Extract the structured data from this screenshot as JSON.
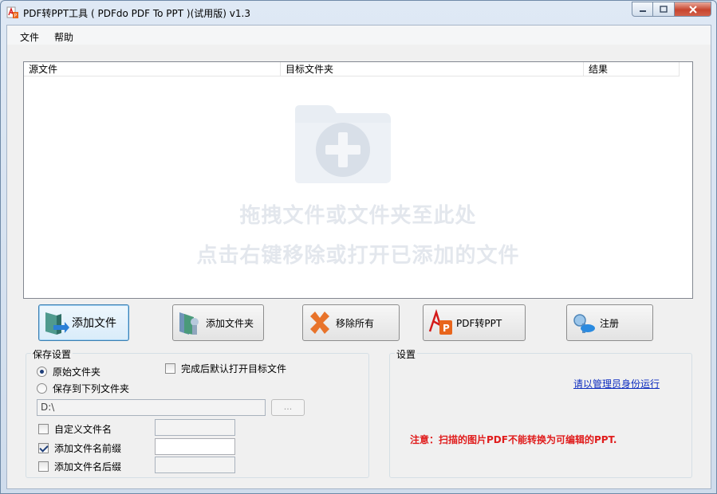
{
  "window": {
    "title": "PDF转PPT工具 ( PDFdo PDF To PPT )(试用版) v1.3"
  },
  "menu": {
    "items": [
      {
        "label": "文件"
      },
      {
        "label": "帮助"
      }
    ]
  },
  "file_list": {
    "columns": [
      "源文件",
      "目标文件夹",
      "结果"
    ],
    "rows": [],
    "hint_line1": "拖拽文件或文件夹至此处",
    "hint_line2": "点击右键移除或打开已添加的文件",
    "hint_icon": "folder-add-icon"
  },
  "toolbar": {
    "add_file": "添加文件",
    "add_folder": "添加文件夹",
    "remove_all": "移除所有",
    "convert": "PDF转PPT",
    "register": "注册"
  },
  "save_settings": {
    "title": "保存设置",
    "option_original": "原始文件夹",
    "option_custom": "保存到下列文件夹",
    "selected_option": "原始文件夹",
    "path_value": "D:\\",
    "browse_label": "...",
    "open_after_label": "完成后默认打开目标文件",
    "open_after_checked": false,
    "custom_name_label": "自定义文件名",
    "custom_name_checked": false,
    "prefix_label": "添加文件名前缀",
    "prefix_checked": true,
    "suffix_label": "添加文件名后缀",
    "suffix_checked": false
  },
  "settings": {
    "title": "设置",
    "admin_link": "请以管理员身份运行",
    "notice": "注意：扫描的图片PDF不能转换为可编辑的PPT."
  },
  "colors": {
    "notice": "#e01c1c",
    "link": "#0d2cbf",
    "focused_border": "#3c7fb1"
  }
}
